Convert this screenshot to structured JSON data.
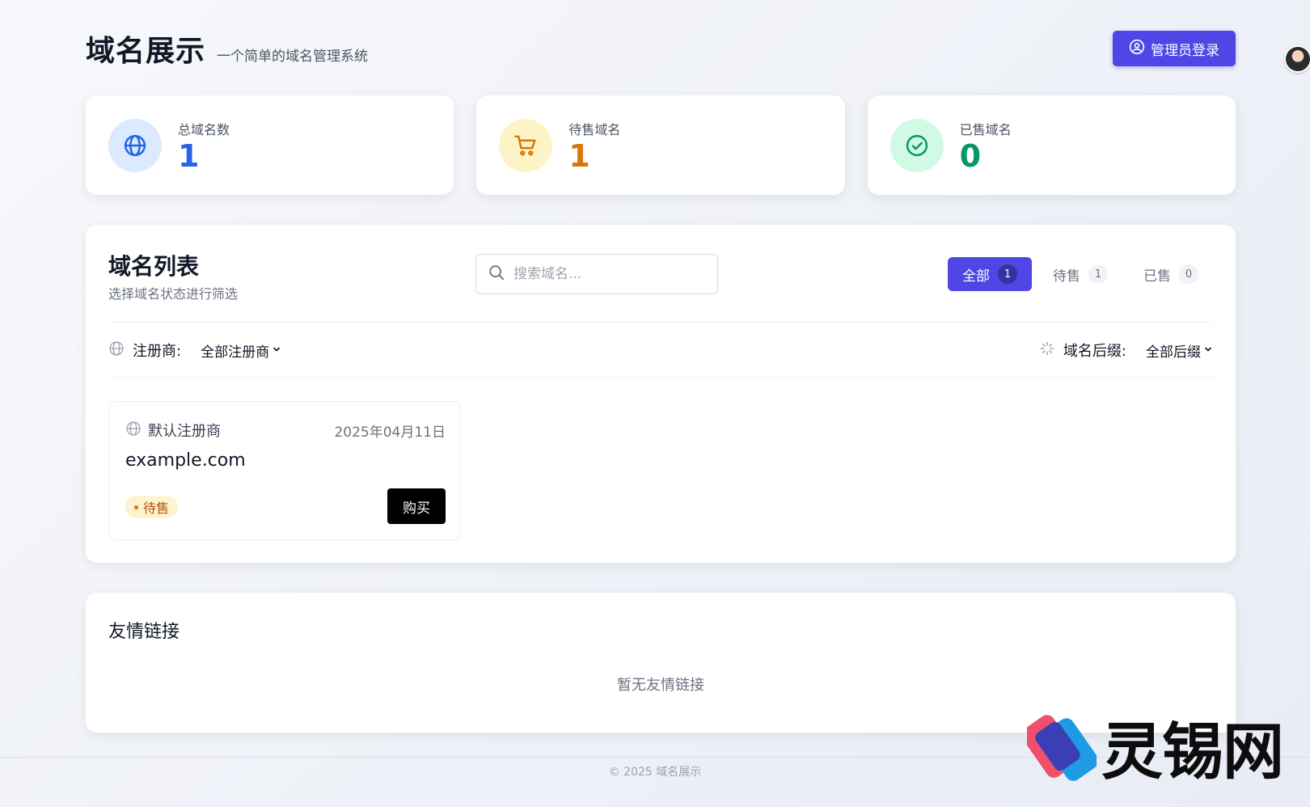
{
  "header": {
    "title": "域名展示",
    "subtitle": "一个简单的域名管理系统",
    "admin_button": "管理员登录"
  },
  "stats": [
    {
      "label": "总域名数",
      "value": "1",
      "icon": "globe-icon",
      "color": "#2563eb",
      "bg": "#dbeafe"
    },
    {
      "label": "待售域名",
      "value": "1",
      "icon": "cart-icon",
      "color": "#d97706",
      "bg": "#fef3c7"
    },
    {
      "label": "已售域名",
      "value": "0",
      "icon": "check-circle-icon",
      "color": "#059669",
      "bg": "#d1fae5"
    }
  ],
  "list": {
    "title": "域名列表",
    "subtitle": "选择域名状态进行筛选",
    "search_placeholder": "搜索域名...",
    "tabs": [
      {
        "label": "全部",
        "count": "1",
        "active": true
      },
      {
        "label": "待售",
        "count": "1",
        "active": false
      },
      {
        "label": "已售",
        "count": "0",
        "active": false
      }
    ],
    "registrar_filter": {
      "label": "注册商:",
      "value": "全部注册商"
    },
    "suffix_filter": {
      "label": "域名后缀:",
      "value": "全部后缀"
    },
    "domains": [
      {
        "registrar": "默认注册商",
        "date": "2025年04月11日",
        "name": "example.com",
        "status": "待售",
        "buy_label": "购买"
      }
    ]
  },
  "links": {
    "title": "友情链接",
    "empty": "暂无友情链接"
  },
  "footer": {
    "text": "© 2025 域名展示"
  },
  "watermark": {
    "text": "灵锡网"
  },
  "colors": {
    "primary": "#4f46e5",
    "pending": "#b45309",
    "sold": "#059669",
    "total": "#2563eb"
  }
}
